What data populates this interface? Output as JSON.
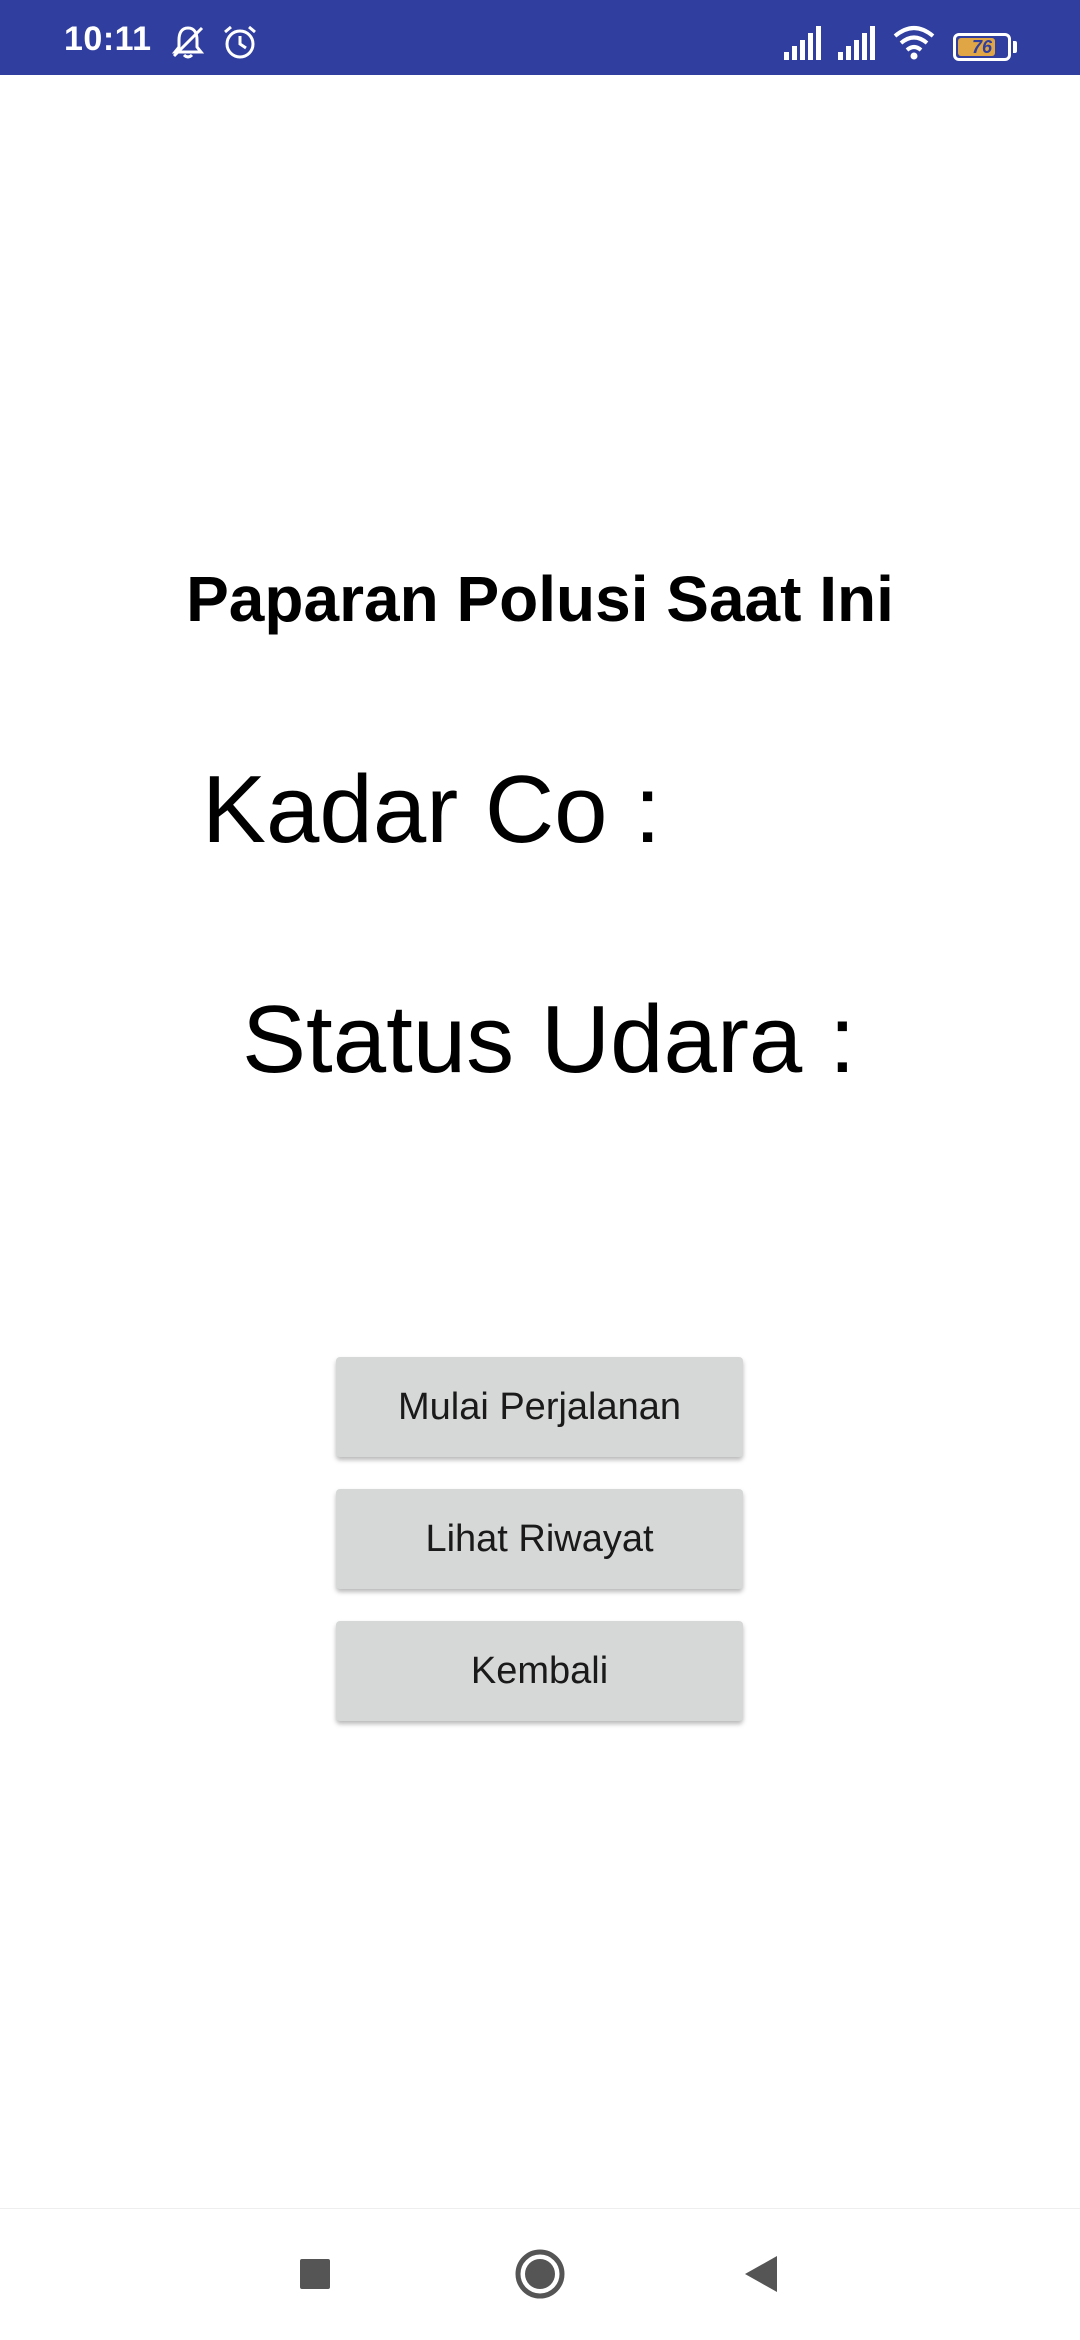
{
  "status_bar": {
    "time": "10:11",
    "battery_level": "76",
    "background_color": "#303f9f",
    "icons": [
      "mute-icon",
      "alarm-icon",
      "signal-icon",
      "signal-icon",
      "wifi-icon",
      "battery-icon"
    ]
  },
  "main": {
    "title": "Paparan Polusi Saat Ini",
    "co_level_label": "Kadar Co :",
    "air_status_label": "Status Udara :"
  },
  "buttons": {
    "start_trip": "Mulai Perjalanan",
    "view_history": "Lihat Riwayat",
    "back": "Kembali"
  },
  "nav_bar": {
    "icons": [
      "recent-apps-icon",
      "home-icon",
      "back-icon"
    ]
  }
}
